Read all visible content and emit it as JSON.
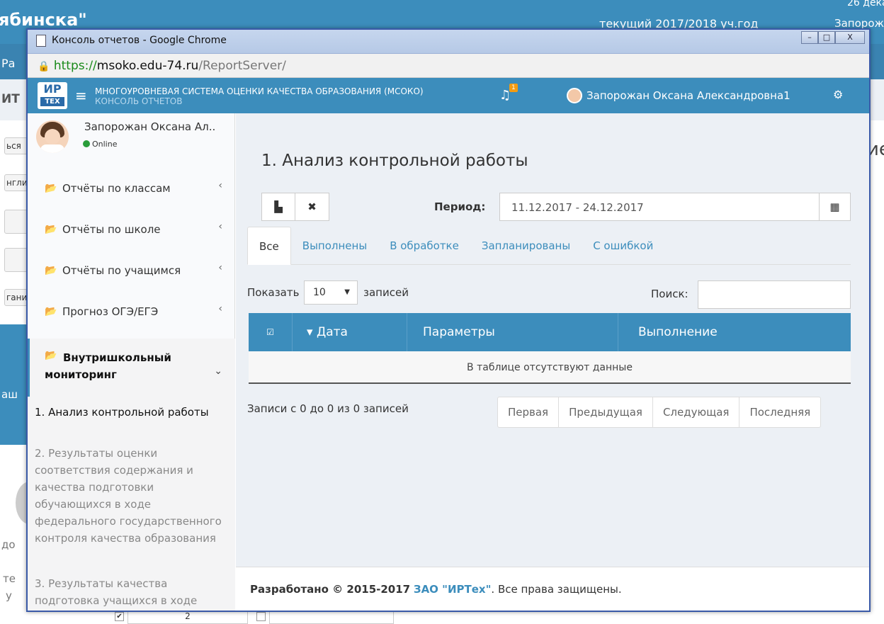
{
  "background": {
    "site_fragment": "ябинска\"",
    "year_fragment": "текущий 2017/2018 уч.год",
    "date_fragment": "26 дека",
    "user_fragment": "Запорожан",
    "nav_fragment": "Ра",
    "head_fragment": "ИТ",
    "right_fragment": "ие",
    "btn1": "ься",
    "btn2": "нгли",
    "btn3": "гани",
    "blue_text": "аш",
    "misc1": "до",
    "misc2": "те",
    "misc3": "у",
    "field_value": "2"
  },
  "window": {
    "title": "Консоль отчетов - Google Chrome",
    "url_proto": "https://",
    "url_host": "msoko.edu-74.ru",
    "url_path": "/ReportServer/",
    "btn_min": "–",
    "btn_max": "□",
    "btn_close": "X"
  },
  "header": {
    "logo_top": "ИР",
    "logo_bottom": "ТЕХ",
    "title": "МНОГОУРОВНЕВАЯ СИСТЕМА ОЦЕНКИ КАЧЕСТВА ОБРАЗОВАНИЯ (МСОКО)",
    "subtitle": "КОНСОЛЬ ОТЧЕТОВ",
    "notifications": "1",
    "user": "Запорожан Оксана Александровна1"
  },
  "sidebar": {
    "user_name": "Запорожан Оксана Ал..",
    "status": "Online",
    "items": [
      {
        "label": "Отчёты по классам"
      },
      {
        "label": "Отчёты по школе"
      },
      {
        "label": "Отчёты по учащимся"
      },
      {
        "label": "Прогноз ОГЭ/ЕГЭ"
      }
    ],
    "active_item": "Внутришкольный мониторинг",
    "subitems": [
      {
        "label": "1. Анализ контрольной работы"
      },
      {
        "label": "2. Результаты оценки соответствия содержания и качества подготовки обучающихся в ходе федерального государственного контроля качества образования"
      },
      {
        "label": "3. Результаты качества подготовка учащихся в ходе"
      }
    ]
  },
  "main": {
    "title": "1. Анализ контрольной работы",
    "period_label": "Период:",
    "period_value": "11.12.2017 - 24.12.2017",
    "tabs": [
      {
        "label": "Все"
      },
      {
        "label": "Выполнены"
      },
      {
        "label": "В обработке"
      },
      {
        "label": "Запланированы"
      },
      {
        "label": "С ошибкой"
      }
    ],
    "show_label": "Показать",
    "show_value": "10",
    "show_suffix": "записей",
    "search_label": "Поиск:",
    "columns": [
      "Дата",
      "Параметры",
      "Выполнение"
    ],
    "empty_text": "В таблице отсутствуют данные",
    "info": "Записи с 0 до 0 из 0 записей",
    "pager": [
      "Первая",
      "Предыдущая",
      "Следующая",
      "Последняя"
    ]
  },
  "footer": {
    "prefix": "Разработано © 2015-2017",
    "company": "ЗАО \"ИРТех\"",
    "suffix": ". Все права защищены."
  }
}
